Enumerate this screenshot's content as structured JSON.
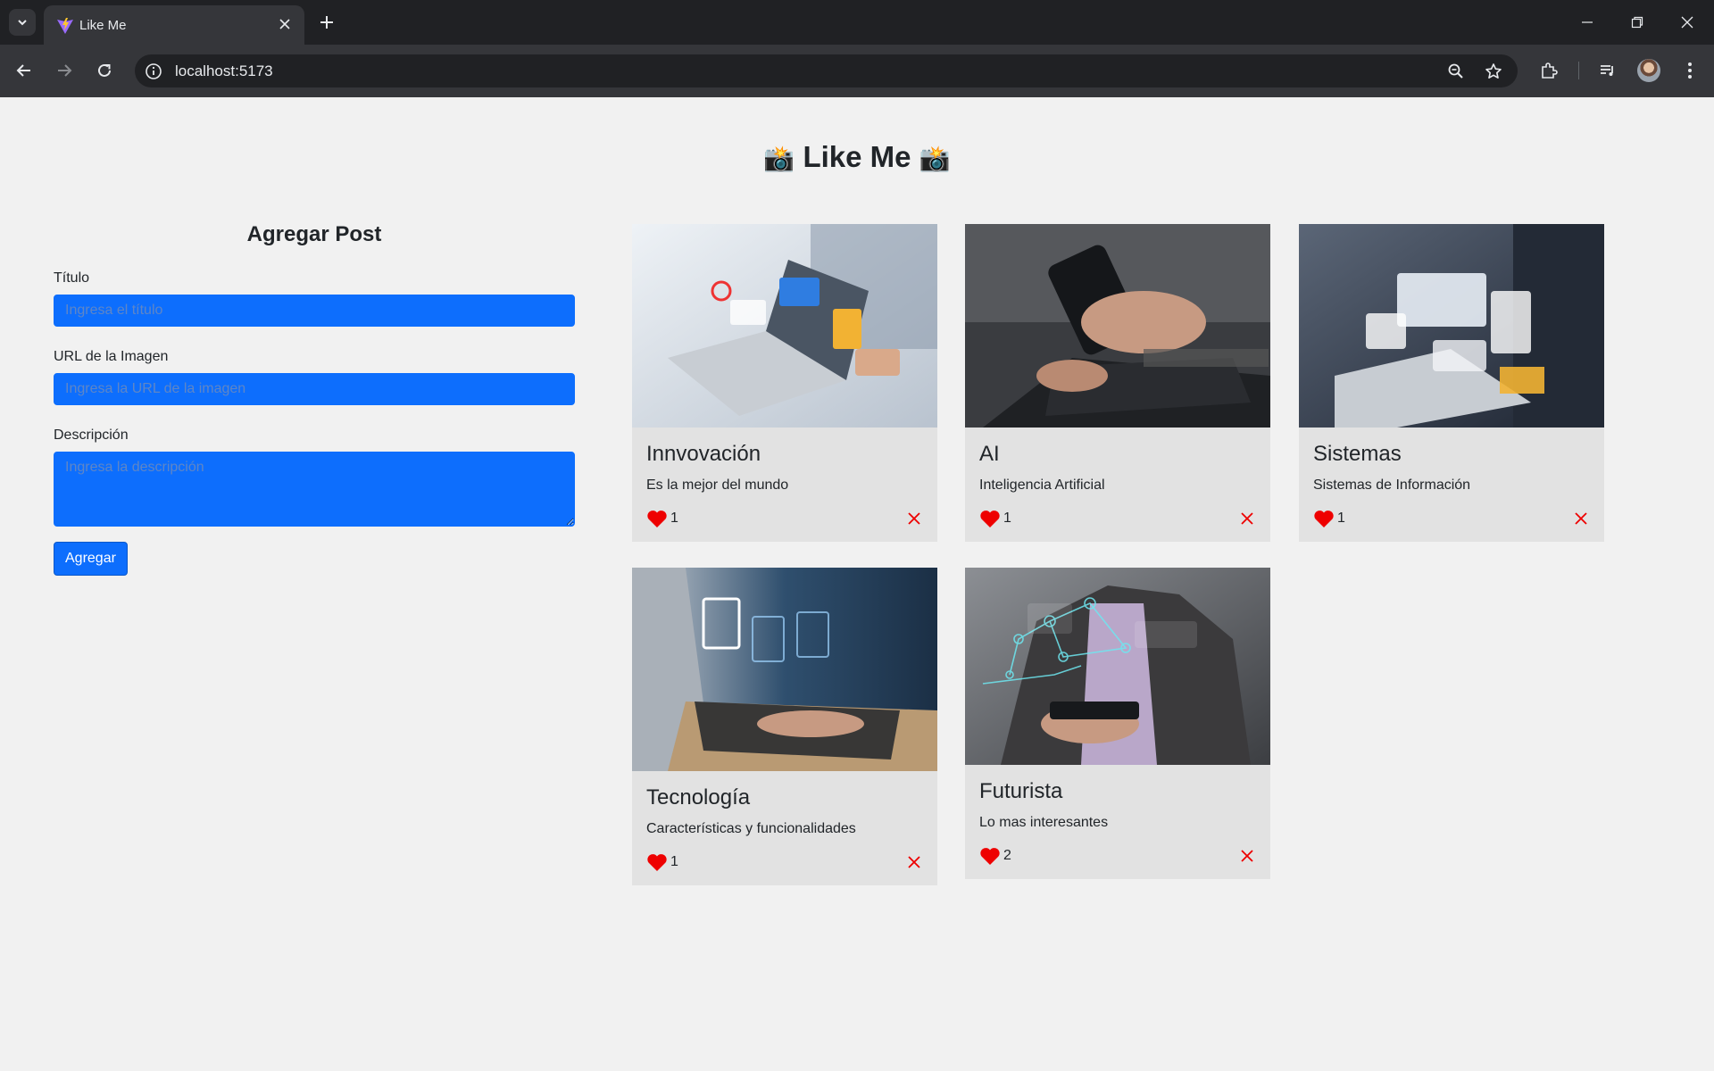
{
  "browser": {
    "tab_title": "Like Me",
    "url": "localhost:5173"
  },
  "app": {
    "title": "Like Me",
    "title_icon": "camera-emoji"
  },
  "form": {
    "heading": "Agregar Post",
    "title_label": "Título",
    "title_placeholder": "Ingresa el título",
    "url_label": "URL de la Imagen",
    "url_placeholder": "Ingresa la URL de la imagen",
    "desc_label": "Descripción",
    "desc_placeholder": "Ingresa la descripción",
    "submit_label": "Agregar",
    "accent_color": "#0d6efd"
  },
  "posts": [
    {
      "title": "Innvovación",
      "description": "Es la mejor del mundo",
      "likes": "1"
    },
    {
      "title": "AI",
      "description": "Inteligencia Artificial",
      "likes": "1"
    },
    {
      "title": "Sistemas",
      "description": "Sistemas de Información",
      "likes": "1"
    },
    {
      "title": "Tecnología",
      "description": "Características y funcionalidades",
      "likes": "1"
    },
    {
      "title": "Futurista",
      "description": "Lo mas interesantes",
      "likes": "2"
    }
  ],
  "colors": {
    "like": "#ee0000",
    "delete": "#ee0000",
    "card_bg": "#e2e2e2"
  }
}
